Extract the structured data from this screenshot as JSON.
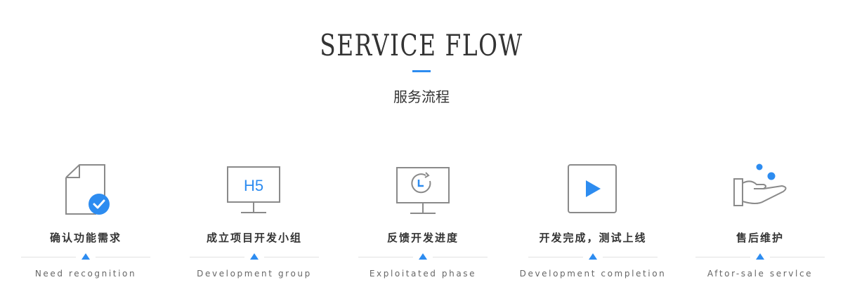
{
  "header": {
    "title": "SERVICE FLOW",
    "subtitle": "服务流程"
  },
  "colors": {
    "accent": "#2d8cf0",
    "icon_stroke": "#8a8a8a",
    "text": "#333333"
  },
  "steps": [
    {
      "label": "确认功能需求",
      "en": "Need recognition",
      "icon": "document-check-icon"
    },
    {
      "label": "成立项目开发小组",
      "en": "Development group",
      "icon": "h5-monitor-icon",
      "icon_text": "H5"
    },
    {
      "label": "反馈开发进度",
      "en": "Exploitated phase",
      "icon": "clock-monitor-icon"
    },
    {
      "label": "开发完成，测试上线",
      "en": "Development completion",
      "icon": "play-icon"
    },
    {
      "label": "售后维护",
      "en": "Aftor-sale servlce",
      "icon": "hand-service-icon"
    }
  ]
}
